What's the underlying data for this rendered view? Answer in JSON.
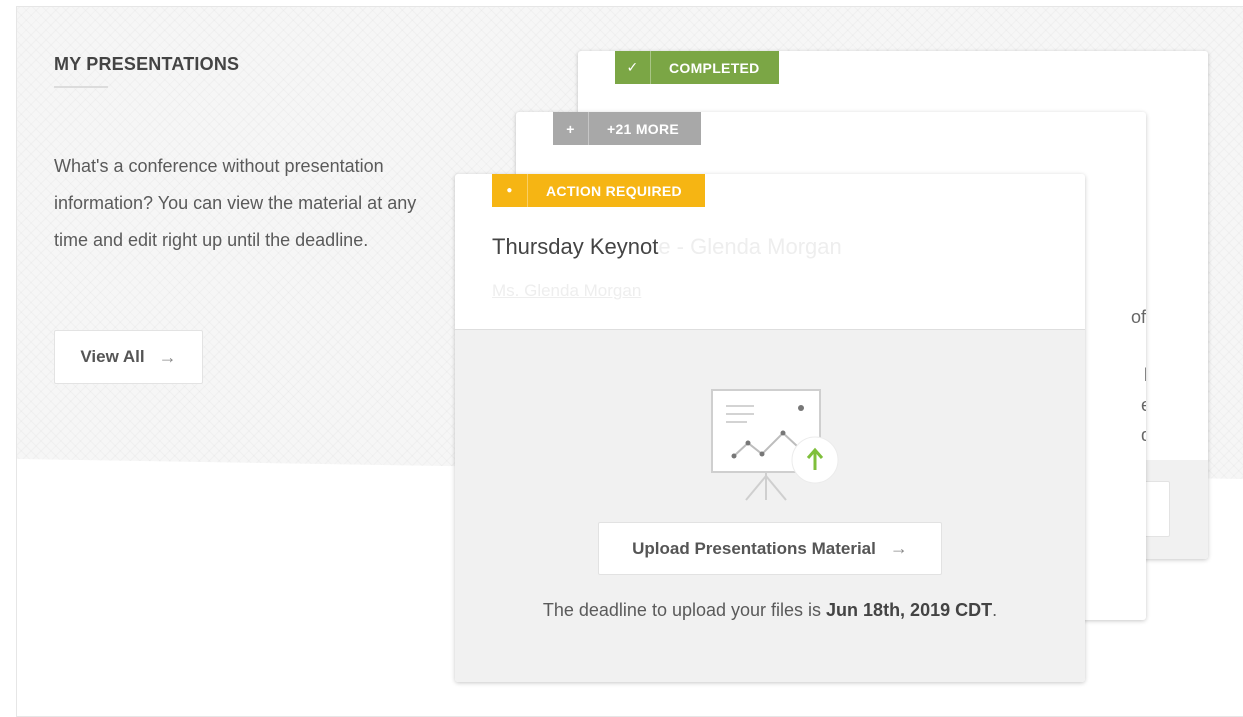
{
  "section": {
    "title": "MY PRESENTATIONS",
    "intro": "What's a conference without presentation information? You can view the material at any time and edit right up until the deadline.",
    "view_all_label": "View All",
    "arrow": "→"
  },
  "cards": {
    "back": {
      "badge_icon": "✓",
      "badge_label": "COMPLETED",
      "badge_color": "#7ba645",
      "button_arrow": "→"
    },
    "mid": {
      "badge_icon": "+",
      "badge_label": "+21 MORE",
      "badge_color": "#a8a8a8",
      "text_fragments": [
        "of",
        "l",
        "e",
        "d"
      ]
    },
    "front": {
      "badge_icon": "●",
      "badge_label": "ACTION REQUIRED",
      "badge_color": "#f6b513",
      "title_visible": "Thursday Keynot",
      "title_faded": "e - Glenda Morgan",
      "speaker": "Ms. Glenda Morgan",
      "upload_label": "Upload Presentations Material",
      "upload_icon": "presentation-upload-icon",
      "deadline_prefix": "The deadline to upload your files is ",
      "deadline_date": "Jun 18th, 2019 CDT",
      "deadline_suffix": "."
    }
  }
}
